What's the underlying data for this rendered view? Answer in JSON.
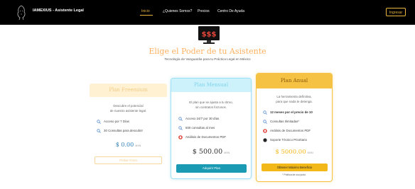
{
  "nav": {
    "brand": "IAMEXIUS - Asistente Legal",
    "links": [
      "Inicio",
      "¿Quienes Somos?",
      "Precios",
      "Centro De Ayuda"
    ],
    "login": "Ingresar"
  },
  "hero": {
    "title": "Elige el Poder de tu Asistente",
    "subtitle": "Tecnología de Vanguardia para tu Práctica Legal en México"
  },
  "plans": [
    {
      "name": "Plan Freemium",
      "description": [
        "Descubre el potencial",
        "de nuestro asistente legal."
      ],
      "features": [
        "Acceso por 7 Días",
        "30 Consultas para descubrir"
      ],
      "price": "$ 0.00",
      "currency": "MXN",
      "button": "Probar Ahora"
    },
    {
      "name": "Plan Mensual",
      "description": [
        "El plan que se ajusta a tu ritmo,",
        "sin contratos forzosos."
      ],
      "features": [
        "Acceso 24/7 por 30 días",
        "500 consultas al mes",
        "Análisis de Documentos PDF"
      ],
      "price": "$ 500.00",
      "currency": "MXN",
      "button": "Adquirir Plan"
    },
    {
      "name": "Plan Anual",
      "description": [
        "La herramienta definitiva,",
        "para que nada te detenga."
      ],
      "features": [
        "12 meses por el precio de 10",
        "Consultas Ilimitadas*",
        "Análisis de Documentos PDF",
        "Soporte Técnico Prioritario"
      ],
      "price": "$ 5000.00",
      "currency": "MXN",
      "button": "Obtener Máximo Beneficio",
      "note": "* Política de uso justo."
    }
  ],
  "colors": {
    "nav_bg": "#000000",
    "accent_gold": "#e9b53b",
    "title_orange": "#ffb060",
    "mensual_button": "#1b9bb3",
    "anual_header": "#f5c243"
  },
  "icons": {
    "logo": "lion-logo-icon",
    "hero": "money-monitor-icon",
    "feature": "magnifier-icon",
    "pdf": "pdf-icon",
    "support": "support-dot-icon"
  }
}
